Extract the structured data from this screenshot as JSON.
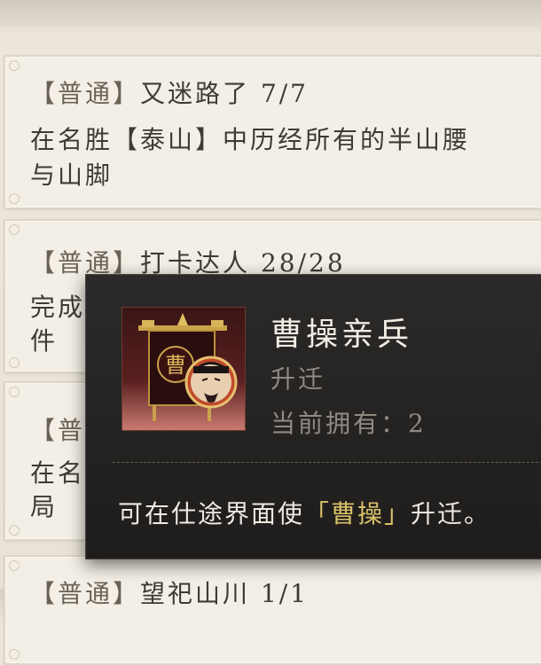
{
  "achievements": [
    {
      "tag": "【普通】",
      "title": "又迷路了",
      "progress": "7/7",
      "desc_line1": "在名胜【泰山】中历经所有的半山腰",
      "desc_line2": "与山脚"
    },
    {
      "tag": "【普通】",
      "title": "打卡达人",
      "progress": "28/28",
      "desc_line1": "完成",
      "desc_line2": "件"
    },
    {
      "tag": "【普",
      "desc_line1": "在名",
      "desc_line2": "局"
    },
    {
      "tag": "【普通】",
      "title": "望祀山川",
      "progress": "1/1"
    }
  ],
  "tooltip": {
    "item_name": "曹操亲兵",
    "item_type": "升迁",
    "owned_label": "当前拥有：",
    "owned_count": "2",
    "desc_prefix": "可在仕途界面使",
    "desc_highlight": "「曹操」",
    "desc_suffix": "升迁。",
    "portrait_glyph": "曹",
    "portrait_icon": "caocao-guard-portrait-icon",
    "highlight_color": "#d8c06a"
  }
}
